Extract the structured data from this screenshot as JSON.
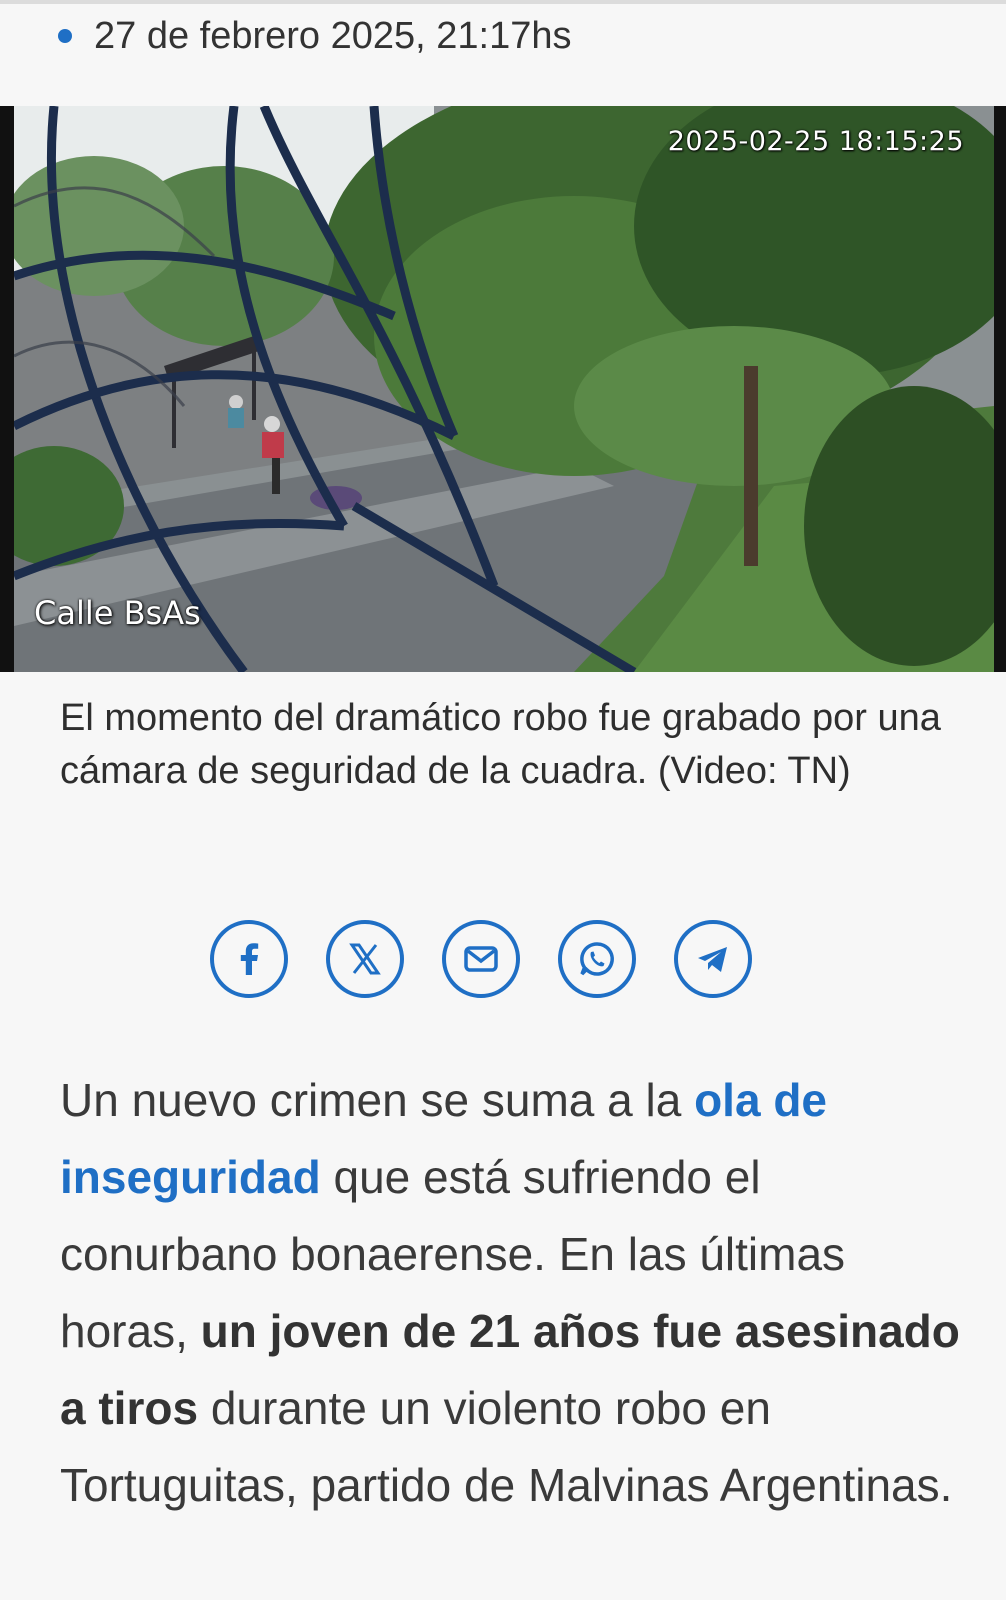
{
  "article": {
    "date": "27 de febrero 2025, 21:17hs",
    "video": {
      "timestamp": "2025-02-25 18:15:25",
      "channel": "Calle BsAs"
    },
    "caption": "El momento del dramático robo fue grabado por una cámara de seguridad de la cuadra. (Video: TN)",
    "body": {
      "p1_intro": "Un nuevo crimen se suma a la ",
      "p1_link": "ola de inseguridad",
      "p1_mid": " que está sufriendo el conurbano bonaerense. En las últimas horas, ",
      "p1_bold": "un joven de 21 años fue asesinado a tiros",
      "p1_end": " durante un violento robo en Tortuguitas, partido de Malvinas Argentinas."
    }
  },
  "share": {
    "icons": [
      "facebook-icon",
      "x-icon",
      "mail-icon",
      "whatsapp-icon",
      "telegram-icon"
    ],
    "accent": "#1f6fc5"
  },
  "colors": {
    "link": "#1f6fc5",
    "text": "#3a3a3a",
    "background": "#f7f7f7"
  }
}
